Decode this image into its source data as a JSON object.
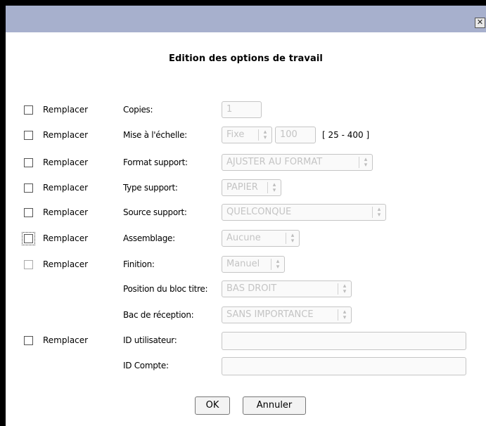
{
  "window": {
    "close_glyph": "✕"
  },
  "dialog": {
    "title": "Edition des options de travail"
  },
  "replace_label": "Remplacer",
  "fields": {
    "copies": {
      "label": "Copies:",
      "value": "1"
    },
    "scale": {
      "label": "Mise à l'échelle:",
      "mode": "Fixe",
      "value": "100",
      "range": "[ 25 - 400 ]"
    },
    "media_format": {
      "label": "Format support:",
      "value": "AJUSTER AU FORMAT"
    },
    "media_type": {
      "label": "Type support:",
      "value": "PAPIER"
    },
    "media_source": {
      "label": "Source support:",
      "value": "QUELCONQUE"
    },
    "collate": {
      "label": "Assemblage:",
      "value": "Aucune"
    },
    "finishing": {
      "label": "Finition:",
      "value": "Manuel"
    },
    "banner_position": {
      "label": "Position du bloc titre:",
      "value": "BAS DROIT"
    },
    "output_tray": {
      "label": "Bac de réception:",
      "value": "SANS IMPORTANCE"
    },
    "user_id": {
      "label": "ID utilisateur:",
      "value": ""
    },
    "account_id": {
      "label": "ID Compte:",
      "value": ""
    }
  },
  "buttons": {
    "ok": "OK",
    "cancel": "Annuler"
  },
  "spinner": {
    "up": "▴",
    "down": "▾"
  }
}
